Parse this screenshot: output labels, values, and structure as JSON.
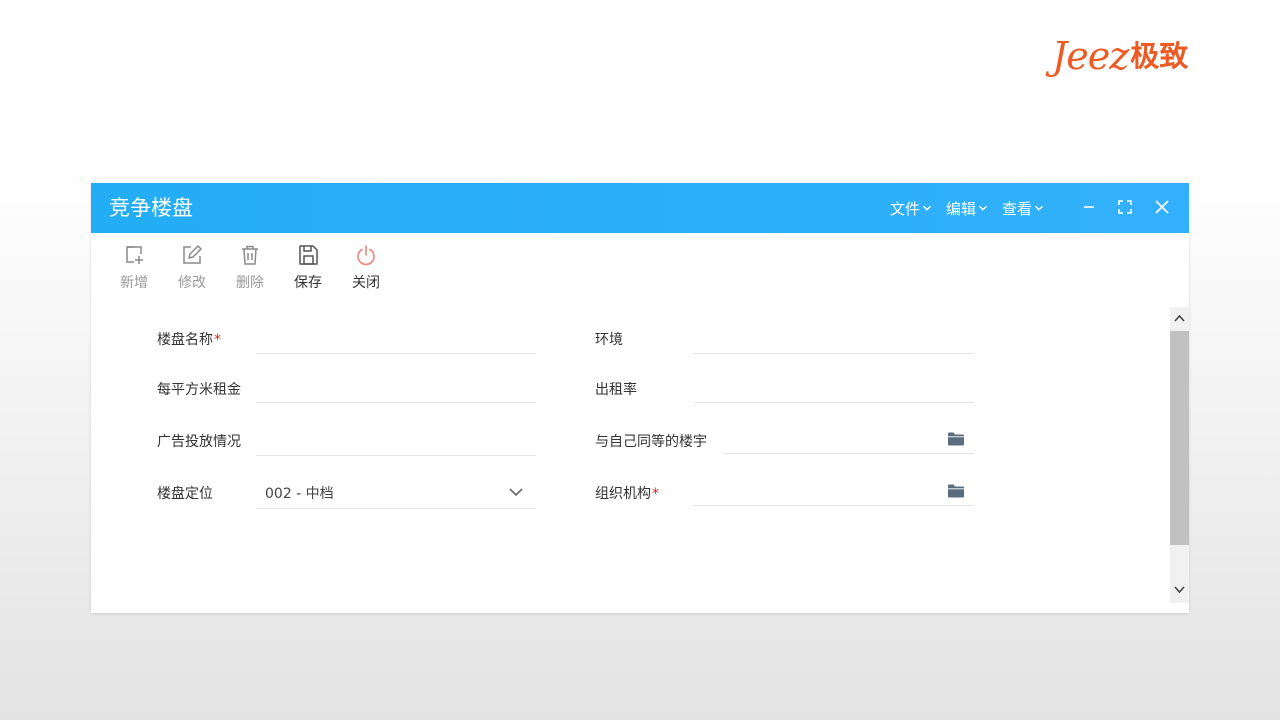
{
  "brand": {
    "latin": "Jeez",
    "cjk": "极致",
    "color": "#ee5a24"
  },
  "window": {
    "title": "竞争楼盘",
    "title_bar_color": "#29aef7",
    "menus": [
      {
        "label": "文件"
      },
      {
        "label": "编辑"
      },
      {
        "label": "查看"
      }
    ],
    "controls": [
      "minimize-icon",
      "maximize-icon",
      "close-icon"
    ]
  },
  "toolbar": {
    "items": [
      {
        "label": "新增",
        "icon": "add-icon",
        "enabled": false
      },
      {
        "label": "修改",
        "icon": "edit-icon",
        "enabled": false
      },
      {
        "label": "删除",
        "icon": "delete-icon",
        "enabled": false
      },
      {
        "label": "保存",
        "icon": "save-icon",
        "enabled": true
      },
      {
        "label": "关闭",
        "icon": "power-icon",
        "enabled": true
      }
    ],
    "close_icon_color": "#f0857a"
  },
  "form": {
    "fields": [
      {
        "label": "楼盘名称",
        "required": true,
        "value": ""
      },
      {
        "label": "环境",
        "required": false,
        "value": ""
      },
      {
        "label": "每平方米租金",
        "required": false,
        "value": ""
      },
      {
        "label": "出租率",
        "required": false,
        "value": ""
      },
      {
        "label": "广告投放情况",
        "required": false,
        "value": ""
      },
      {
        "label": "与自己同等的楼宇",
        "required": false,
        "value": "",
        "picker": "folder-icon"
      },
      {
        "label": "楼盘定位",
        "required": false,
        "value": "002 - 中档",
        "type": "select"
      },
      {
        "label": "组织机构",
        "required": true,
        "value": "",
        "picker": "folder-icon"
      }
    ],
    "required_mark": "*",
    "required_color": "#e02020"
  }
}
